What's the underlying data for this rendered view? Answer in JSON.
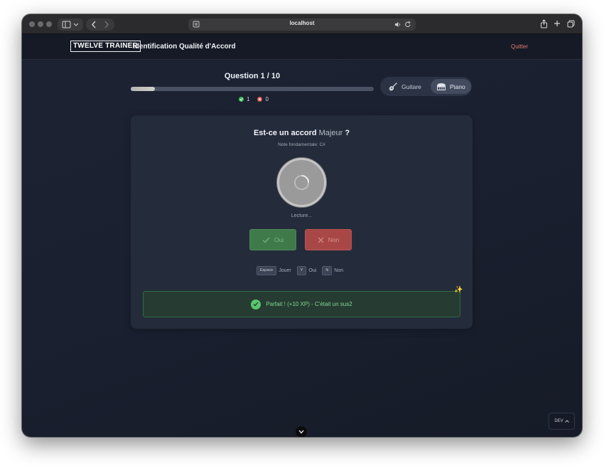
{
  "browser": {
    "address": "localhost"
  },
  "header": {
    "logo": "TWELVE TRAINER",
    "title": "Identification Qualité d'Accord",
    "quit_label": "Quitter"
  },
  "quiz": {
    "question_label": "Question 1 / 10",
    "progress": 0.1,
    "correct_count": "1",
    "wrong_count": "0"
  },
  "instrument": {
    "options": [
      {
        "label": "Guitare",
        "icon": "guitar-icon",
        "active": false
      },
      {
        "label": "Piano",
        "icon": "piano-icon",
        "active": true
      }
    ]
  },
  "card": {
    "question_prefix": "Est-ce un accord",
    "quality": "Majeur",
    "question_suffix": "?",
    "root_note": "Note fondamentale: C#",
    "status": "Lecture...",
    "yes_label": "Oui",
    "no_label": "Non",
    "shortcuts": [
      {
        "key": "Espace",
        "label": "Jouer"
      },
      {
        "key": "Y",
        "label": "Oui"
      },
      {
        "key": "N",
        "label": "Non"
      }
    ],
    "feedback": "Parfait ! (+10 XP) - C'était un sus2",
    "feedback_icon": "check-circle-icon",
    "sparkle": "✨"
  },
  "dev": {
    "label": "DEV"
  },
  "colors": {
    "background": "#1a2030",
    "card": "#242b3a",
    "success": "#58c56d",
    "danger": "#d8534a",
    "quit": "#e47a6e"
  }
}
